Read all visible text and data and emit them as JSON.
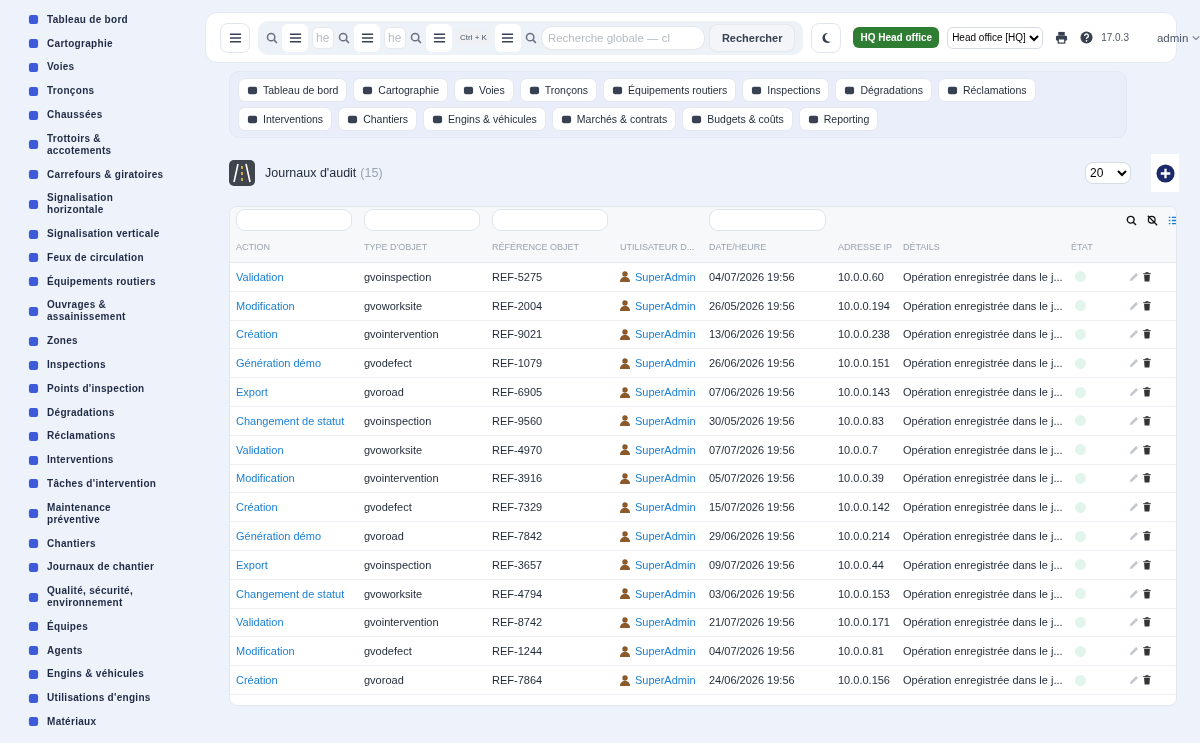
{
  "sidebar": {
    "items": [
      {
        "label": "Tableau de bord"
      },
      {
        "label": "Cartographie"
      },
      {
        "label": "Voies"
      },
      {
        "label": "Tronçons"
      },
      {
        "label": "Chaussées"
      },
      {
        "label": "Trottoirs & accotements"
      },
      {
        "label": "Carrefours & giratoires"
      },
      {
        "label": "Signalisation horizontale"
      },
      {
        "label": "Signalisation verticale"
      },
      {
        "label": "Feux de circulation"
      },
      {
        "label": "Équipements routiers"
      },
      {
        "label": "Ouvrages & assainissement"
      },
      {
        "label": "Zones"
      },
      {
        "label": "Inspections"
      },
      {
        "label": "Points d'inspection"
      },
      {
        "label": "Dégradations"
      },
      {
        "label": "Réclamations"
      },
      {
        "label": "Interventions"
      },
      {
        "label": "Tâches d'intervention"
      },
      {
        "label": "Maintenance préventive"
      },
      {
        "label": "Chantiers"
      },
      {
        "label": "Journaux de chantier"
      },
      {
        "label": "Qualité, sécurité, environnement"
      },
      {
        "label": "Équipes"
      },
      {
        "label": "Agents"
      },
      {
        "label": "Engins & véhicules"
      },
      {
        "label": "Utilisations d'engins"
      },
      {
        "label": "Matériaux"
      }
    ]
  },
  "topbar": {
    "search_fragments": [
      {
        "placeholder": "he"
      },
      {
        "placeholder": "he"
      },
      {
        "shortcut": "Ctrl + K"
      }
    ],
    "search": {
      "placeholder": "Recherche globale — cl"
    },
    "search_button": "Rechercher",
    "company_badge": "HQ Head office",
    "company_select": "Head office [HQ]",
    "version": "17.0.3",
    "user": "admin"
  },
  "quick_links": [
    {
      "label": "Tableau de bord"
    },
    {
      "label": "Cartographie"
    },
    {
      "label": "Voies"
    },
    {
      "label": "Tronçons"
    },
    {
      "label": "Équipements routiers"
    },
    {
      "label": "Inspections"
    },
    {
      "label": "Dégradations"
    },
    {
      "label": "Réclamations"
    },
    {
      "label": "Interventions"
    },
    {
      "label": "Chantiers"
    },
    {
      "label": "Engins & véhicules"
    },
    {
      "label": "Marchés & contrats"
    },
    {
      "label": "Budgets & coûts"
    },
    {
      "label": "Reporting"
    }
  ],
  "page": {
    "title": "Journaux d'audit",
    "count": "(15)",
    "page_size": "20"
  },
  "table": {
    "columns": [
      "ACTION",
      "TYPE D'OBJET",
      "RÉFÉRENCE OBJET",
      "UTILISATEUR D...",
      "DATE/HEURE",
      "ADRESSE IP",
      "DÉTAILS",
      "ÉTAT"
    ],
    "rows": [
      {
        "action": "Validation",
        "type": "gvoinspection",
        "ref": "REF-5275",
        "user": "SuperAdmin",
        "date": "04/07/2026 19:56",
        "ip": "10.0.0.60",
        "details": "Opération enregistrée dans le j..."
      },
      {
        "action": "Modification",
        "type": "gvoworksite",
        "ref": "REF-2004",
        "user": "SuperAdmin",
        "date": "26/05/2026 19:56",
        "ip": "10.0.0.194",
        "details": "Opération enregistrée dans le j..."
      },
      {
        "action": "Création",
        "type": "gvointervention",
        "ref": "REF-9021",
        "user": "SuperAdmin",
        "date": "13/06/2026 19:56",
        "ip": "10.0.0.238",
        "details": "Opération enregistrée dans le j..."
      },
      {
        "action": "Génération démo",
        "type": "gvodefect",
        "ref": "REF-1079",
        "user": "SuperAdmin",
        "date": "26/06/2026 19:56",
        "ip": "10.0.0.151",
        "details": "Opération enregistrée dans le j..."
      },
      {
        "action": "Export",
        "type": "gvoroad",
        "ref": "REF-6905",
        "user": "SuperAdmin",
        "date": "07/06/2026 19:56",
        "ip": "10.0.0.143",
        "details": "Opération enregistrée dans le j..."
      },
      {
        "action": "Changement de statut",
        "type": "gvoinspection",
        "ref": "REF-9560",
        "user": "SuperAdmin",
        "date": "30/05/2026 19:56",
        "ip": "10.0.0.83",
        "details": "Opération enregistrée dans le j..."
      },
      {
        "action": "Validation",
        "type": "gvoworksite",
        "ref": "REF-4970",
        "user": "SuperAdmin",
        "date": "07/07/2026 19:56",
        "ip": "10.0.0.7",
        "details": "Opération enregistrée dans le j..."
      },
      {
        "action": "Modification",
        "type": "gvointervention",
        "ref": "REF-3916",
        "user": "SuperAdmin",
        "date": "05/07/2026 19:56",
        "ip": "10.0.0.39",
        "details": "Opération enregistrée dans le j..."
      },
      {
        "action": "Création",
        "type": "gvodefect",
        "ref": "REF-7329",
        "user": "SuperAdmin",
        "date": "15/07/2026 19:56",
        "ip": "10.0.0.142",
        "details": "Opération enregistrée dans le j..."
      },
      {
        "action": "Génération démo",
        "type": "gvoroad",
        "ref": "REF-7842",
        "user": "SuperAdmin",
        "date": "29/06/2026 19:56",
        "ip": "10.0.0.214",
        "details": "Opération enregistrée dans le j..."
      },
      {
        "action": "Export",
        "type": "gvoinspection",
        "ref": "REF-3657",
        "user": "SuperAdmin",
        "date": "09/07/2026 19:56",
        "ip": "10.0.0.44",
        "details": "Opération enregistrée dans le j..."
      },
      {
        "action": "Changement de statut",
        "type": "gvoworksite",
        "ref": "REF-4794",
        "user": "SuperAdmin",
        "date": "03/06/2026 19:56",
        "ip": "10.0.0.153",
        "details": "Opération enregistrée dans le j..."
      },
      {
        "action": "Validation",
        "type": "gvointervention",
        "ref": "REF-8742",
        "user": "SuperAdmin",
        "date": "21/07/2026 19:56",
        "ip": "10.0.0.171",
        "details": "Opération enregistrée dans le j..."
      },
      {
        "action": "Modification",
        "type": "gvodefect",
        "ref": "REF-1244",
        "user": "SuperAdmin",
        "date": "04/07/2026 19:56",
        "ip": "10.0.0.81",
        "details": "Opération enregistrée dans le j..."
      },
      {
        "action": "Création",
        "type": "gvoroad",
        "ref": "REF-7864",
        "user": "SuperAdmin",
        "date": "24/06/2026 19:56",
        "ip": "10.0.0.156",
        "details": "Opération enregistrée dans le j..."
      }
    ]
  }
}
